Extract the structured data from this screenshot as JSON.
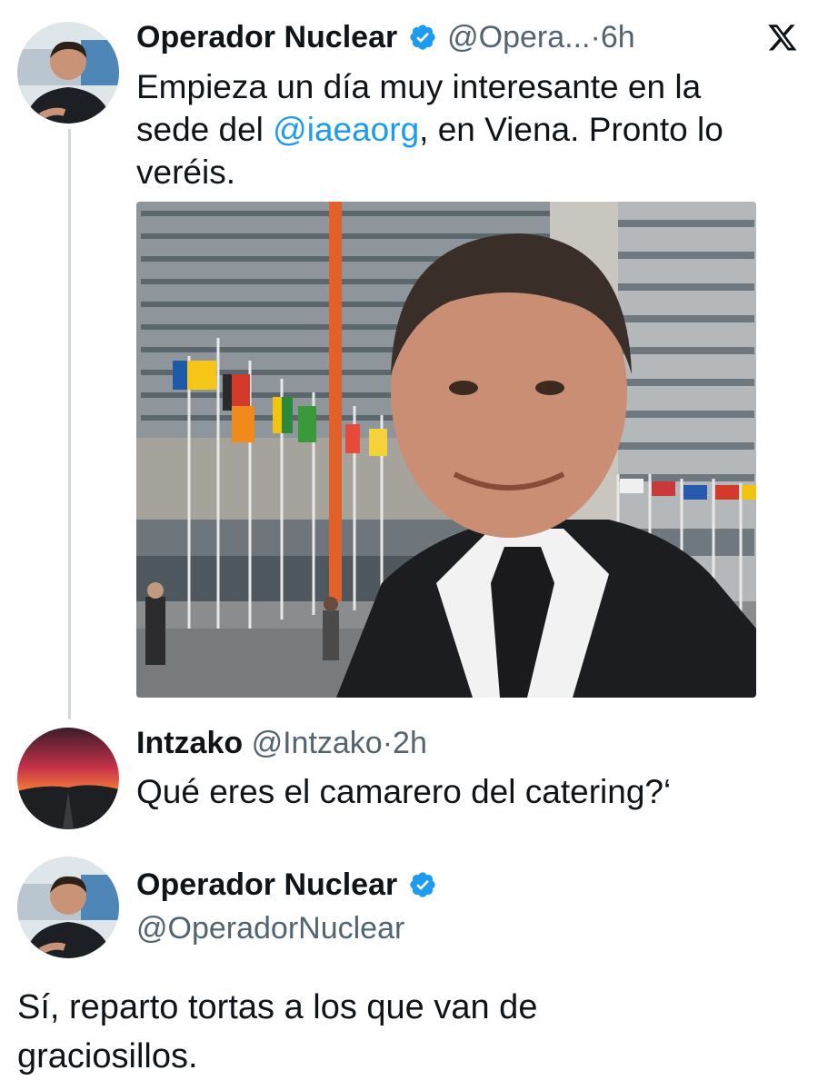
{
  "header": {
    "x_logo": "x-logo-icon"
  },
  "tweet1": {
    "author_name": "Operador Nuclear",
    "handle": "@Opera...",
    "sep": "·",
    "time": "6h",
    "text_before": "Empieza un día muy interesante en la sede del ",
    "mention": "@iaeaorg",
    "text_after": ", en Viena. Pronto lo veréis.",
    "photo_icon": "photo-selfie-iaea"
  },
  "reply": {
    "author_name": "Intzako",
    "handle": "@Intzako",
    "sep": "·",
    "time": "2h",
    "text": "Qué eres el camarero del catering?‘"
  },
  "tweet3": {
    "author_name": "Operador Nuclear",
    "handle": "@OperadorNuclear",
    "text": "Sí, reparto tortas a los que van de graciosillos."
  },
  "colors": {
    "link": "#1d9bf0",
    "verified": "#1d9bf0",
    "secondary": "#536471",
    "line": "#cfd9de"
  }
}
